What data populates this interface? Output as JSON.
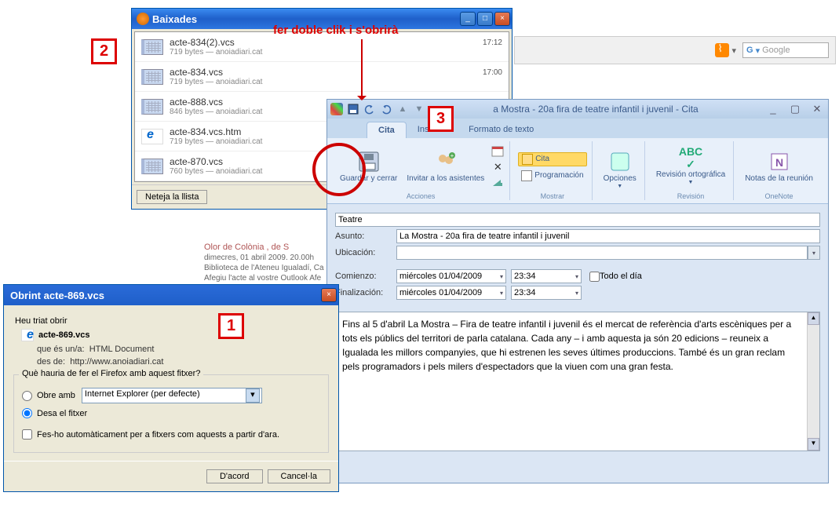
{
  "markers": {
    "m1": "1",
    "m2": "2",
    "m3": "3"
  },
  "redAnnotation": "fer doble clik i s'obrirà",
  "toolbar": {
    "search_placeholder": "Google"
  },
  "backgroundContent": {
    "title": "Olor de Colònia , de S",
    "line1": "dimecres, 01 abril 2009. 20.00h",
    "line2": "Biblioteca de l'Ateneu Igualadí, Ca",
    "line3": "Afegiu l'acte al vostre Outlook Afe"
  },
  "downloads": {
    "title": "Baixades",
    "minimize": "_",
    "maximize": "□",
    "close": "×",
    "items": [
      {
        "name": "acte-834(2).vcs",
        "meta": "719 bytes — anoiadiari.cat",
        "time": "17:12",
        "icon": "cal"
      },
      {
        "name": "acte-834.vcs",
        "meta": "719 bytes — anoiadiari.cat",
        "time": "17:00",
        "icon": "cal"
      },
      {
        "name": "acte-888.vcs",
        "meta": "846 bytes — anoiadiari.cat",
        "time": "",
        "icon": "cal"
      },
      {
        "name": "acte-834.vcs.htm",
        "meta": "719 bytes — anoiadiari.cat",
        "time": "",
        "icon": "ie"
      },
      {
        "name": "acte-870.vcs",
        "meta": "760 bytes — anoiadiari.cat",
        "time": "",
        "icon": "cal"
      }
    ],
    "clearButton": "Neteja la llista"
  },
  "fileDialog": {
    "title": "Obrint acte-869.vcs",
    "close": "×",
    "chosen": "Heu triat obrir",
    "fileName": "acte-869.vcs",
    "typeLabel": "que és un/a:",
    "typeValue": "HTML Document",
    "fromLabel": "des de:",
    "fromValue": "http://www.anoiadiari.cat",
    "question": "Què hauria de fer el Firefox amb aquest fitxer?",
    "openWith": "Obre amb",
    "openWithApp": "Internet Explorer (per defecte)",
    "saveFile": "Desa el fitxer",
    "autoCheck": "Fes-ho automàticament per a fitxers com aquests a partir d'ara.",
    "ok": "D'acord",
    "cancel": "Cancel·la"
  },
  "outlook": {
    "windowTitle": "a Mostra - 20a fira de teatre infantil i juvenil - Cita",
    "winMin": "_",
    "winMax": "▢",
    "winClose": "✕",
    "tabs": {
      "cita": "Cita",
      "insertar": "Insertar",
      "formato": "Formato de texto"
    },
    "ribbon": {
      "guardarCerrar": "Guardar y cerrar",
      "invitarAsistentes": "Invitar a los asistentes",
      "acciones": "Acciones",
      "citaBtn": "Cita",
      "programacion": "Programación",
      "mostrar": "Mostrar",
      "opciones": "Opciones",
      "revisionOrtografica": "Revisión ortográfica",
      "revision": "Revisión",
      "notasReunion": "Notas de la reunión",
      "onenote": "OneNote"
    },
    "form": {
      "categoryValue": "Teatre",
      "asuntoLabel": "Asunto:",
      "asuntoValue": "La Mostra - 20a fira de teatre infantil i juvenil",
      "ubicacionLabel": "Ubicación:",
      "ubicacionValue": "",
      "comienzoLabel": "Comienzo:",
      "comienzoDate": "miércoles 01/04/2009",
      "comienzoTime": "23:34",
      "finLabel": "Finalización:",
      "finDate": "miércoles 01/04/2009",
      "finTime": "23:34",
      "allDayLabel": "Todo el día"
    },
    "bodyText": "Fins al 5 d'abril  La Mostra – Fira de teatre infantil i juvenil és el mercat de referència d'arts escèniques per a tots els públics del territori de parla catalana. Cada any – i amb aquesta ja són 20 edicions – reuneix a Igualada les millors companyies, que hi estrenen les seves últimes produccions. També és un gran reclam pels programadors i pels milers d'espectadors que la viuen com una gran festa."
  }
}
